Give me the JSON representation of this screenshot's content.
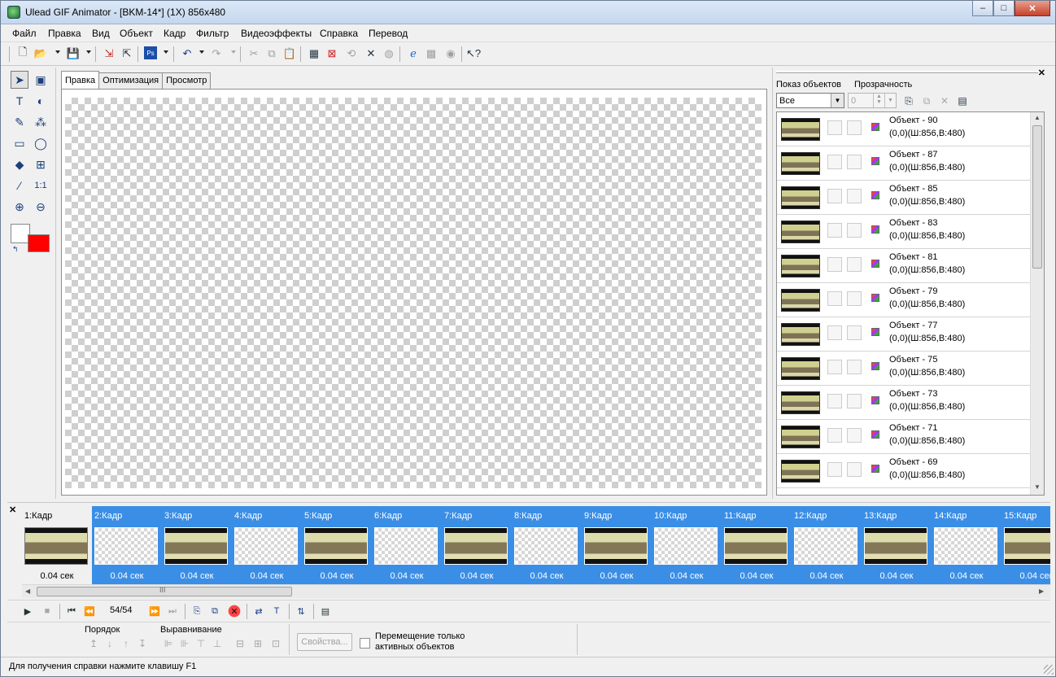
{
  "window": {
    "title": "Ulead GIF Animator - [BKM-14*] (1X) 856x480",
    "minimize": "–",
    "maximize": "□",
    "close": "✕"
  },
  "menu": [
    "Файл",
    "Правка",
    "Вид",
    "Объект",
    "Кадр",
    "Фильтр",
    "Видеоэффекты",
    "Справка",
    "Перевод"
  ],
  "toolbar_icons": [
    "new-file-icon",
    "open-folder-icon",
    "save-icon",
    "import-icon",
    "export-icon",
    "photoshop-icon",
    "undo-icon",
    "redo-icon",
    "cut-icon",
    "copy-icon",
    "paste-icon",
    "crop-icon",
    "resize-icon",
    "rotate-icon",
    "delete-icon",
    "optimize-icon",
    "browser-preview-icon",
    "preview-icon",
    "web-icon",
    "context-help-icon"
  ],
  "tools": [
    {
      "name": "pointer-tool-icon",
      "glyph": "➤"
    },
    {
      "name": "object-select-tool-icon",
      "glyph": "▣"
    },
    {
      "name": "text-tool-icon",
      "glyph": "T"
    },
    {
      "name": "path-tool-icon",
      "glyph": "◐"
    },
    {
      "name": "brush-tool-icon",
      "glyph": "✎"
    },
    {
      "name": "magic-wand-tool-icon",
      "glyph": "⁂"
    },
    {
      "name": "eraser-tool-icon",
      "glyph": "▭"
    },
    {
      "name": "lasso-tool-icon",
      "glyph": "◯"
    },
    {
      "name": "fill-tool-icon",
      "glyph": "◆"
    },
    {
      "name": "crop-tool-icon",
      "glyph": "⊞"
    },
    {
      "name": "eyedropper-tool-icon",
      "glyph": "⁄"
    },
    {
      "name": "actual-size-tool-icon",
      "glyph": "1:1"
    },
    {
      "name": "zoom-in-tool-icon",
      "glyph": "⊕"
    },
    {
      "name": "zoom-out-tool-icon",
      "glyph": "⊖"
    }
  ],
  "colors": {
    "foreground": "#ff0000",
    "background": "#ffffff",
    "frames_background": "#3a8ee6"
  },
  "editor": {
    "tabs": [
      "Правка",
      "Оптимизация",
      "Просмотр"
    ],
    "active_tab": 0
  },
  "objects_panel": {
    "show_label": "Показ объектов",
    "show_value": "Все",
    "opacity_label": "Прозрачность",
    "opacity_value": "0",
    "objects": [
      {
        "name": "Объект - 90",
        "geometry": "(0,0)(Ш:856,В:480)"
      },
      {
        "name": "Объект - 87",
        "geometry": "(0,0)(Ш:856,В:480)"
      },
      {
        "name": "Объект - 85",
        "geometry": "(0,0)(Ш:856,В:480)"
      },
      {
        "name": "Объект - 83",
        "geometry": "(0,0)(Ш:856,В:480)"
      },
      {
        "name": "Объект - 81",
        "geometry": "(0,0)(Ш:856,В:480)"
      },
      {
        "name": "Объект - 79",
        "geometry": "(0,0)(Ш:856,В:480)"
      },
      {
        "name": "Объект - 77",
        "geometry": "(0,0)(Ш:856,В:480)"
      },
      {
        "name": "Объект - 75",
        "geometry": "(0,0)(Ш:856,В:480)"
      },
      {
        "name": "Объект - 73",
        "geometry": "(0,0)(Ш:856,В:480)"
      },
      {
        "name": "Объект - 71",
        "geometry": "(0,0)(Ш:856,В:480)"
      },
      {
        "name": "Объект - 69",
        "geometry": "(0,0)(Ш:856,В:480)"
      }
    ]
  },
  "frames": [
    {
      "label": "1:Кадр",
      "delay": "0.04 сек",
      "image": true
    },
    {
      "label": "2:Кадр",
      "delay": "0.04 сек",
      "image": false
    },
    {
      "label": "3:Кадр",
      "delay": "0.04 сек",
      "image": true
    },
    {
      "label": "4:Кадр",
      "delay": "0.04 сек",
      "image": false
    },
    {
      "label": "5:Кадр",
      "delay": "0.04 сек",
      "image": true
    },
    {
      "label": "6:Кадр",
      "delay": "0.04 сек",
      "image": false
    },
    {
      "label": "7:Кадр",
      "delay": "0.04 сек",
      "image": true
    },
    {
      "label": "8:Кадр",
      "delay": "0.04 сек",
      "image": false
    },
    {
      "label": "9:Кадр",
      "delay": "0.04 сек",
      "image": true
    },
    {
      "label": "10:Кадр",
      "delay": "0.04 сек",
      "image": false
    },
    {
      "label": "11:Кадр",
      "delay": "0.04 сек",
      "image": true
    },
    {
      "label": "12:Кадр",
      "delay": "0.04 сек",
      "image": false
    },
    {
      "label": "13:Кадр",
      "delay": "0.04 сек",
      "image": true
    },
    {
      "label": "14:Кадр",
      "delay": "0.04 сек",
      "image": false
    },
    {
      "label": "15:Кадр",
      "delay": "0.04 сек",
      "image": true
    }
  ],
  "playback": {
    "counter": "54/54"
  },
  "properties": {
    "order_label": "Порядок",
    "align_label": "Выравнивание",
    "properties_button": "Свойства...",
    "move_active_only": "Перемещение только активных объектов"
  },
  "status": "Для получения справки нажмите клавишу F1"
}
